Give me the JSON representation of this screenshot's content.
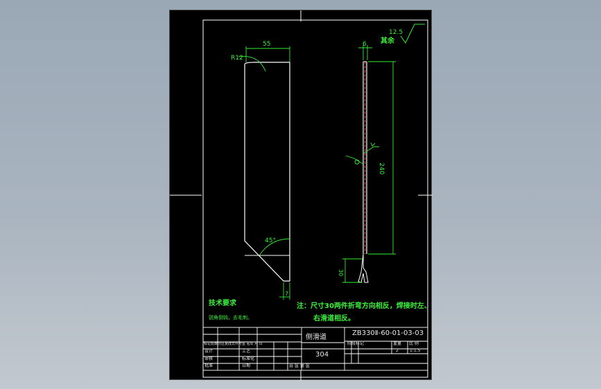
{
  "colors": {
    "background_top": "#9aa8b6",
    "sheet": "#000000",
    "outline": "#ffffff",
    "dimension": "#33ee33",
    "hidden_line": "#ee3333"
  },
  "surface_finish": {
    "value": "12.5",
    "note": "其余"
  },
  "dims": {
    "width_top": "55",
    "radius": "R12",
    "angle": "45°",
    "bottom_width": "7",
    "thickness": "6",
    "length": "240",
    "foot": "30"
  },
  "tech_requirements": {
    "title": "技术要求",
    "body": "锐角倒钝，去毛刺。"
  },
  "note": {
    "line1": "注：尺寸30两件折弯方向相反，焊接时左、",
    "line2": "右滑道相反。"
  },
  "title_block": {
    "part_name": "侧滑道",
    "drawing_no": "ZB330Ⅱ-60-01-03-03",
    "material": "304",
    "scale_label": "比 例",
    "scale": "1:1.5",
    "weight_label": "重量",
    "quantity": "2",
    "design": "设计",
    "review": "审核",
    "approve": "批准",
    "process": "工艺",
    "standard": "标准化",
    "date": "日期",
    "revision_header": "标记处数分区更改文件号签 名年 月 日",
    "sheets": "共   张   第   张",
    "stage_marks": "阶段标记"
  }
}
